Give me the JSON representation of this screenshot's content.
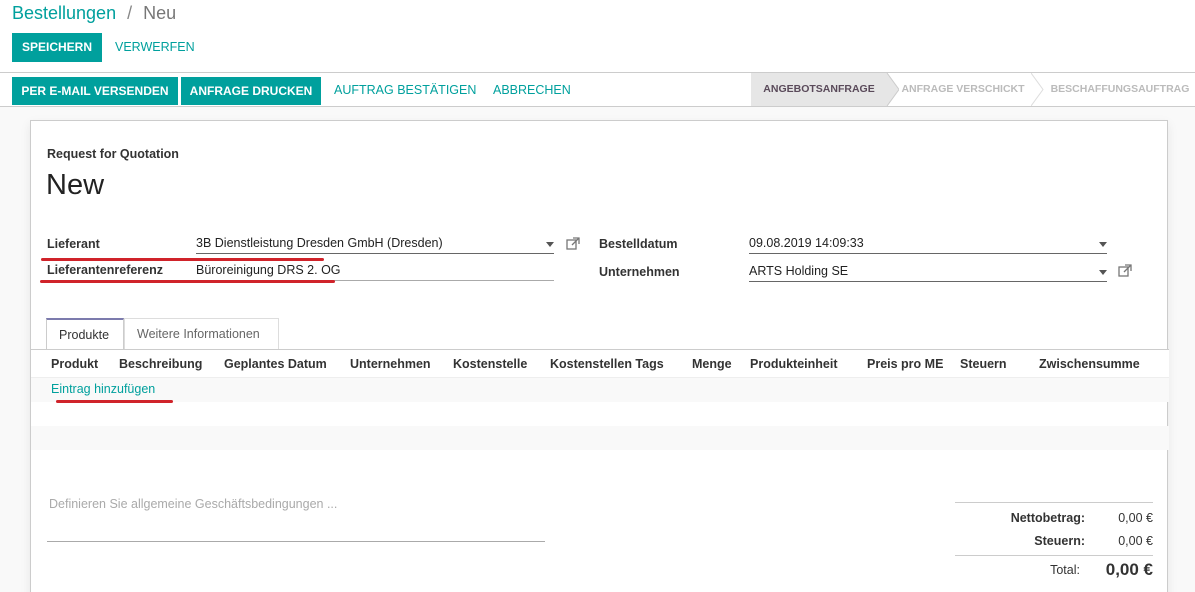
{
  "breadcrumb": {
    "parent": "Bestellungen",
    "separator": "/",
    "current": "Neu"
  },
  "toolbar": {
    "save_label": "SPEICHERN",
    "discard_label": "VERWERFEN"
  },
  "header_buttons": {
    "send_email": "PER E-MAIL VERSENDEN",
    "print_rfq": "ANFRAGE DRUCKEN",
    "confirm_order": "AUFTRAG BESTÄTIGEN",
    "cancel": "ABBRECHEN"
  },
  "statusbar": {
    "steps": [
      {
        "label": "ANGEBOTSANFRAGE",
        "active": true
      },
      {
        "label": "ANFRAGE VERSCHICKT",
        "active": false
      },
      {
        "label": "BESCHAFFUNGSAUFTRAG",
        "active": false
      }
    ]
  },
  "form": {
    "doc_type": "Request for Quotation",
    "title": "New",
    "vendor_label": "Lieferant",
    "vendor_value": "3B Dienstleistung Dresden GmbH (Dresden)",
    "vendor_ref_label": "Lieferantenreferenz",
    "vendor_ref_value": "Büroreinigung DRS 2. OG",
    "order_date_label": "Bestelldatum",
    "order_date_value": "09.08.2019 14:09:33",
    "company_label": "Unternehmen",
    "company_value": "ARTS Holding SE"
  },
  "tabs": [
    {
      "label": "Produkte",
      "active": true
    },
    {
      "label": "Weitere Informationen",
      "active": false
    }
  ],
  "table": {
    "columns": [
      "Produkt",
      "Beschreibung",
      "Geplantes Datum",
      "Unternehmen",
      "Kostenstelle",
      "Kostenstellen Tags",
      "Menge",
      "Produkteinheit",
      "Preis pro ME",
      "Steuern",
      "Zwischensumme"
    ],
    "add_line": "Eintrag hinzufügen"
  },
  "notes_placeholder": "Definieren Sie allgemeine Geschäftsbedingungen ...",
  "totals": {
    "untaxed_label": "Nettobetrag:",
    "untaxed_value": "0,00 €",
    "taxes_label": "Steuern:",
    "taxes_value": "0,00 €",
    "total_label": "Total:",
    "total_value": "0,00 €"
  },
  "colors": {
    "accent": "#00A09D",
    "annotation": "#d0232a",
    "tab_active": "#7C7BAD"
  },
  "icons": [
    "external-link-icon",
    "dropdown-caret-icon"
  ]
}
